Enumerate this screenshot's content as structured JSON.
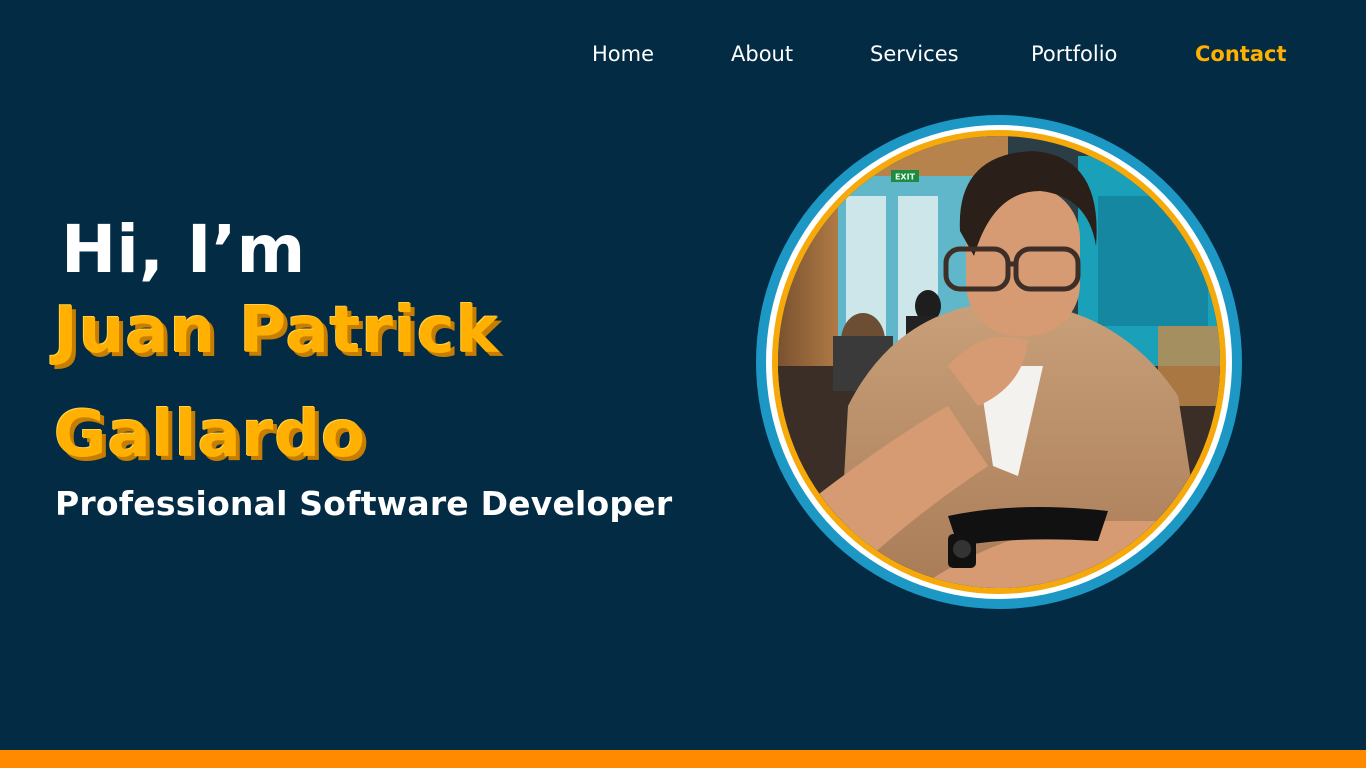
{
  "nav": {
    "items": [
      {
        "label": "Home"
      },
      {
        "label": "About"
      },
      {
        "label": "Services"
      },
      {
        "label": "Portfolio"
      },
      {
        "label": "Contact"
      }
    ]
  },
  "hero": {
    "greeting": "Hi, I’m",
    "name_line1": "Juan Patrick",
    "name_line2": "Gallardo",
    "role": "Professional Software Developer"
  },
  "portrait": {
    "exit_sign": "EXIT"
  },
  "colors": {
    "background": "#032B44",
    "accent": "#FFB000",
    "ring": "#1D97C4",
    "bottom_bar": "#FF8A00",
    "text": "#FFFFFF"
  }
}
